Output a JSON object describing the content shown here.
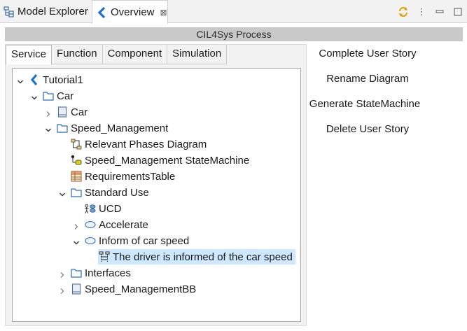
{
  "view_tabs": [
    {
      "label": "Model Explorer",
      "icon": "model-explorer-icon",
      "active": false
    },
    {
      "label": "Overview",
      "icon": "capella-icon",
      "active": true,
      "close_glyph": "⊠"
    }
  ],
  "view_tools": {
    "sync_icon": "sync-icon",
    "menu_glyph": "⋮",
    "minimize_glyph": "▭",
    "maximize_glyph": "☐"
  },
  "process_title": "CIL4Sys Process",
  "subtabs": [
    "Service",
    "Function",
    "Component",
    "Simulation"
  ],
  "tree": [
    {
      "label": "Tutorial1",
      "icon": "capella-icon",
      "depth": 0,
      "twisty": "expanded"
    },
    {
      "label": "Car",
      "icon": "folder-icon",
      "depth": 1,
      "twisty": "expanded"
    },
    {
      "label": "Car",
      "icon": "block-icon",
      "depth": 2,
      "twisty": "collapsed"
    },
    {
      "label": "Speed_Management",
      "icon": "folder-icon",
      "depth": 2,
      "twisty": "expanded"
    },
    {
      "label": "Relevant Phases Diagram",
      "icon": "phases-diagram-icon",
      "depth": 3,
      "twisty": "none"
    },
    {
      "label": "Speed_Management StateMachine",
      "icon": "statemachine-icon",
      "depth": 3,
      "twisty": "none"
    },
    {
      "label": "RequirementsTable",
      "icon": "table-icon",
      "depth": 3,
      "twisty": "none"
    },
    {
      "label": "Standard Use",
      "icon": "folder-icon",
      "depth": 3,
      "twisty": "expanded"
    },
    {
      "label": "UCD",
      "icon": "ucd-icon",
      "depth": 4,
      "twisty": "none"
    },
    {
      "label": "Accelerate",
      "icon": "usecase-icon",
      "depth": 4,
      "twisty": "collapsed"
    },
    {
      "label": "Inform of car speed",
      "icon": "usecase-icon",
      "depth": 4,
      "twisty": "expanded"
    },
    {
      "label": "The driver is informed of the car speed",
      "icon": "sequence-diagram-icon",
      "depth": 5,
      "twisty": "none",
      "selected": true
    },
    {
      "label": "Interfaces",
      "icon": "folder-icon",
      "depth": 3,
      "twisty": "collapsed"
    },
    {
      "label": "Speed_ManagementBB",
      "icon": "block-icon",
      "depth": 3,
      "twisty": "collapsed"
    }
  ],
  "actions": [
    "Complete User Story",
    "Rename Diagram",
    "Generate StateMachine",
    "Delete User Story"
  ],
  "colors": {
    "accent": "#1f6fd6",
    "selection": "#cde8ff",
    "header": "#c9c9c9",
    "folder": "#2a6cc4"
  }
}
